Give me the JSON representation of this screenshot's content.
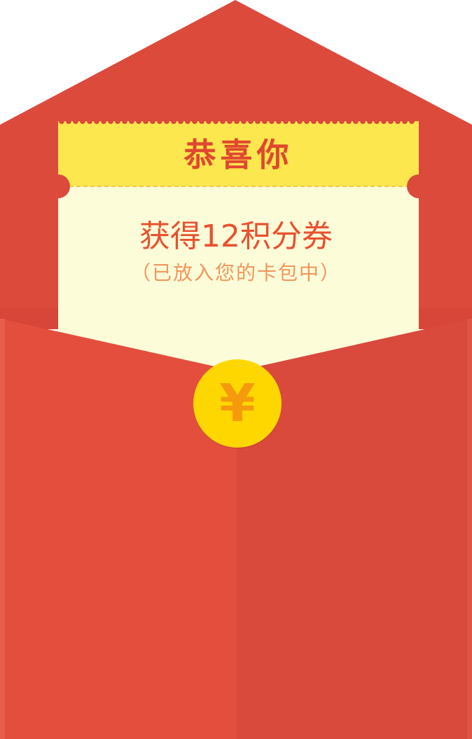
{
  "card": {
    "title": "恭喜你",
    "prize_text": "获得12积分券",
    "note_text": "（已放入您的卡包中）"
  },
  "coin": {
    "icon_name": "yuan-coin-icon",
    "glyph": "¥"
  },
  "colors": {
    "envelope_back": "#dc4a3c",
    "envelope_front_left": "#e44f3d",
    "envelope_front_right": "#d9493c",
    "card_header": "#fde74e",
    "card_body": "#fcfcd9",
    "title_text": "#e0482f",
    "prize_text": "#e9512e",
    "note_text": "#f2965a",
    "coin": "#fed700",
    "coin_glyph": "#f59a0c"
  }
}
